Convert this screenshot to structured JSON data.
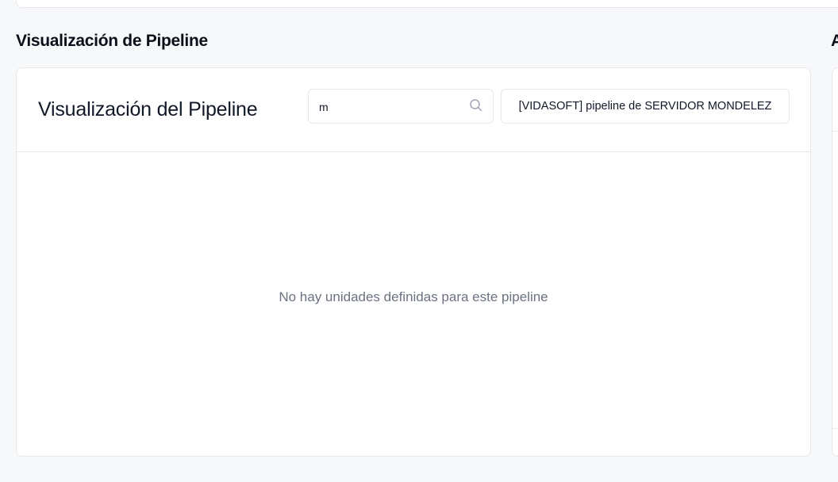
{
  "section": {
    "title": "Visualización de Pipeline",
    "right_title_partial": "A"
  },
  "card": {
    "title": "Visualización del Pipeline",
    "search": {
      "value": "m",
      "icon": "search-icon"
    },
    "pipeline_select": {
      "selected": "[VIDASOFT] pipeline de SERVIDOR MONDELEZ"
    },
    "empty_message": "No hay unidades definidas para este pipeline"
  },
  "colors": {
    "background": "#f7f8fa",
    "card": "#ffffff",
    "border": "#e5e7eb",
    "muted_text": "#6b7280",
    "title_text": "#111827"
  }
}
